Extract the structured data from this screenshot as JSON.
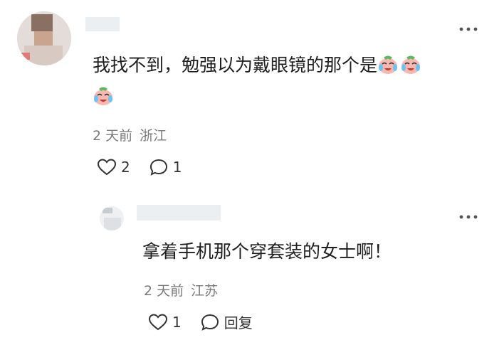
{
  "comments": [
    {
      "text": "我找不到，勉强以为戴眼镜的那个是",
      "emoji_count": 3,
      "emoji_name": "crying-laughing-face",
      "time": "2 天前",
      "location": "浙江",
      "likes": "2",
      "replies": "1",
      "more_label": "⋮"
    },
    {
      "text": "拿着手机那个穿套装的女士啊！",
      "time": "2 天前",
      "location": "江苏",
      "likes": "1",
      "reply_label": "回复",
      "more_label": "⋮"
    }
  ],
  "colors": {
    "text": "#1f1f1f",
    "meta": "#7a7a7a",
    "icon": "#333333"
  }
}
